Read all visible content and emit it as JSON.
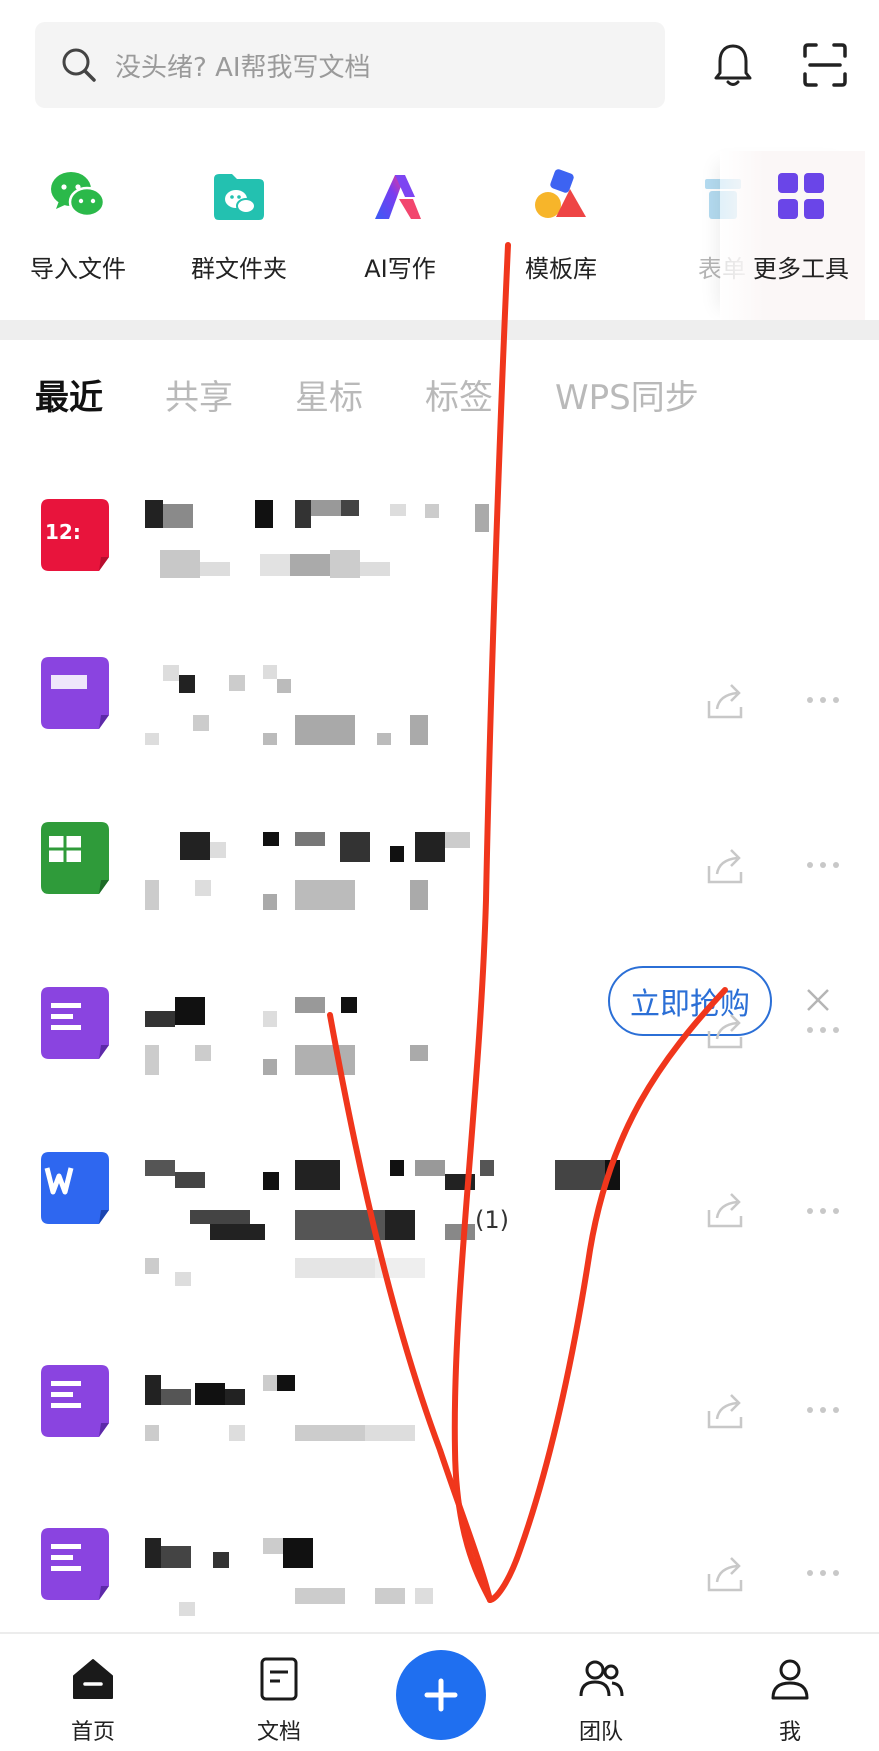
{
  "search": {
    "placeholder": "没头绪? AI帮我写文档"
  },
  "tools": [
    {
      "label": "导入文件",
      "icon": "wechat-icon"
    },
    {
      "label": "群文件夹",
      "icon": "group-folder-icon"
    },
    {
      "label": "AI写作",
      "icon": "ai-writing-icon"
    },
    {
      "label": "模板库",
      "icon": "template-library-icon"
    },
    {
      "label": "表单",
      "icon": "form-icon"
    },
    {
      "label": "更多工具",
      "icon": "more-tools-icon"
    }
  ],
  "tabs": [
    "最近",
    "共享",
    "星标",
    "标签",
    "WPS同步"
  ],
  "promo": {
    "icon_text": "12:",
    "button_label": "立即抢购"
  },
  "files": [
    {
      "type": "promo",
      "icon": "calendar-promo-icon",
      "color": "#e8143c"
    },
    {
      "type": "doc",
      "icon": "doc-icon",
      "color": "#8a44e0"
    },
    {
      "type": "sheet",
      "icon": "sheet-icon",
      "color": "#2f9b3a"
    },
    {
      "type": "doc",
      "icon": "doc-icon",
      "color": "#8a44e0"
    },
    {
      "type": "word",
      "icon": "word-icon",
      "color": "#2e67f0",
      "title_fragment": "(1)"
    },
    {
      "type": "doc",
      "icon": "doc-icon",
      "color": "#8a44e0"
    },
    {
      "type": "doc",
      "icon": "doc-icon",
      "color": "#8a44e0"
    }
  ],
  "nav": [
    {
      "label": "首页",
      "icon": "home-icon"
    },
    {
      "label": "文档",
      "icon": "document-icon"
    },
    {
      "label": "团队",
      "icon": "team-icon"
    },
    {
      "label": "我",
      "icon": "profile-icon"
    }
  ],
  "colors": {
    "accent": "#1f6ff0",
    "promo_border": "#2b6fd6",
    "annotation": "#f0361c"
  }
}
